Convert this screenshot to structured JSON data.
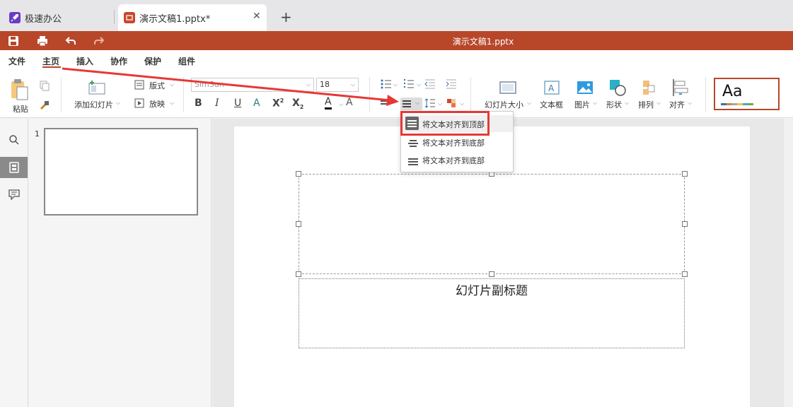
{
  "tabs": [
    {
      "label": "极速办公",
      "icon": "rocket-icon"
    },
    {
      "label": "演示文稿1.pptx*",
      "icon": "presentation-icon"
    }
  ],
  "titlebar": {
    "title": "演示文稿1.pptx"
  },
  "menu": [
    "文件",
    "主页",
    "插入",
    "协作",
    "保护",
    "组件"
  ],
  "ribbon": {
    "paste": "粘贴",
    "add_slide": "添加幻灯片",
    "layout": "版式",
    "play": "放映",
    "font": "SimSun",
    "size": "18",
    "slide_size": "幻灯片大小",
    "textbox": "文本框",
    "picture": "图片",
    "shape": "形状",
    "arrange": "排列",
    "align": "对齐",
    "theme_sample": "Aa"
  },
  "slides": {
    "number": "1"
  },
  "dropdown": [
    "将文本对齐到顶部",
    "将文本对齐到底部",
    "将文本对齐到底部"
  ],
  "slide": {
    "subtitle_placeholder": "幻灯片副标题"
  },
  "colors": {
    "accent": "#b8472a",
    "highlight": "#e53935"
  }
}
